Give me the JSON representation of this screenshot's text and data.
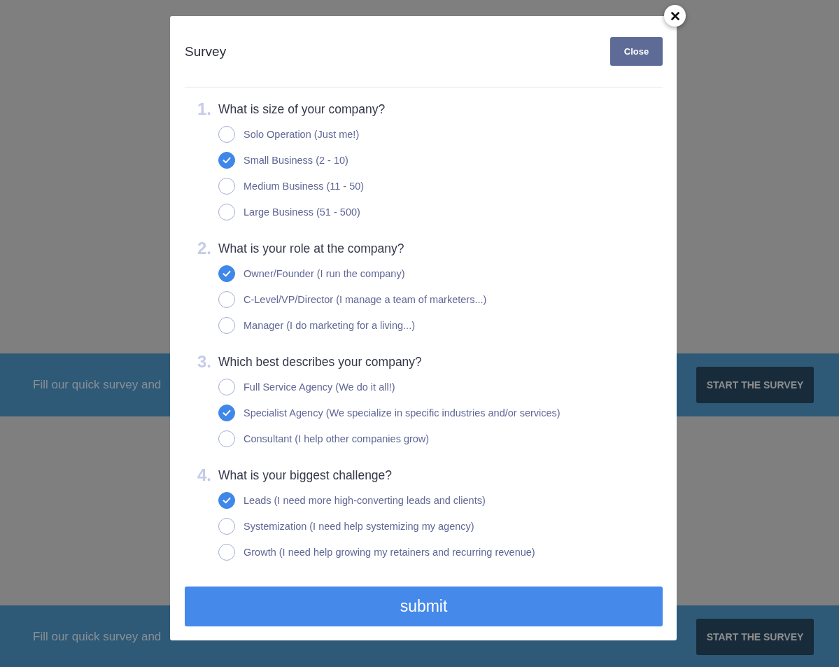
{
  "banners": [
    {
      "text": "Fill our quick survey and",
      "button": "START THE SURVEY"
    },
    {
      "text": "Fill our quick survey and",
      "button": "START THE SURVEY"
    }
  ],
  "modal": {
    "title": "Survey",
    "close_button": "Close",
    "questions": [
      {
        "number": "1.",
        "text": "What is size of your company?",
        "options": [
          {
            "label": "Solo Operation (Just me!)",
            "selected": false
          },
          {
            "label": "Small Business (2 - 10)",
            "selected": true
          },
          {
            "label": "Medium Business (11 - 50)",
            "selected": false
          },
          {
            "label": "Large Business (51 - 500)",
            "selected": false
          }
        ]
      },
      {
        "number": "2.",
        "text": "What is your role at the company?",
        "options": [
          {
            "label": "Owner/Founder (I run the company)",
            "selected": true
          },
          {
            "label": "C-Level/VP/Director (I manage a team of marketers...)",
            "selected": false
          },
          {
            "label": "Manager (I do marketing for a living...)",
            "selected": false
          }
        ]
      },
      {
        "number": "3.",
        "text": "Which best describes your company?",
        "options": [
          {
            "label": "Full Service Agency (We do it all!)",
            "selected": false
          },
          {
            "label": "Specialist Agency (We specialize in specific industries and/or services)",
            "selected": true
          },
          {
            "label": "Consultant (I help other companies grow)",
            "selected": false
          }
        ]
      },
      {
        "number": "4.",
        "text": "What is your biggest challenge?",
        "options": [
          {
            "label": "Leads (I need more high-converting leads and clients)",
            "selected": true
          },
          {
            "label": "Systemization (I need help systemizing my agency)",
            "selected": false
          },
          {
            "label": "Growth (I need help growing my retainers and recurring revenue)",
            "selected": false
          }
        ]
      }
    ],
    "submit_button": "submit"
  }
}
